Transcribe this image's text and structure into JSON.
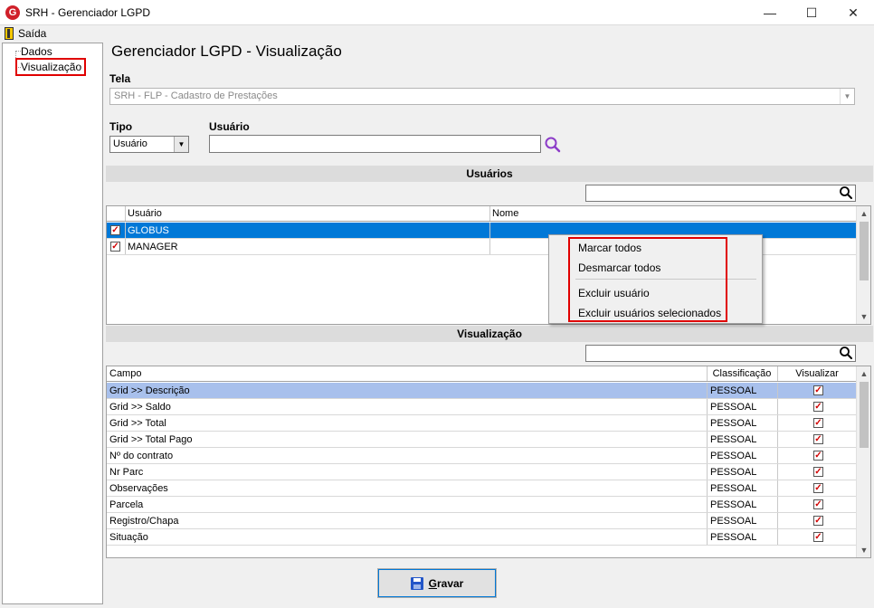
{
  "window": {
    "title": "SRH - Gerenciador LGPD",
    "minimize_glyph": "—",
    "maximize_glyph": "☐",
    "close_glyph": "✕"
  },
  "menu": {
    "exit_label": "Saída",
    "exit_icon": "exit-door-icon"
  },
  "nav": {
    "items": [
      {
        "label": "Dados",
        "selected": false
      },
      {
        "label": "Visualização",
        "selected": true
      }
    ]
  },
  "page": {
    "title": "Gerenciador LGPD - Visualização"
  },
  "form": {
    "tela_label": "Tela",
    "tela_value": "SRH - FLP - Cadastro de Prestações",
    "tipo_label": "Tipo",
    "tipo_value": "Usuário",
    "usuario_label": "Usuário",
    "usuario_value": ""
  },
  "users_section": {
    "header": "Usuários",
    "search_value": "",
    "columns": [
      "Usuário",
      "Nome"
    ],
    "rows": [
      {
        "checked": true,
        "usuario": "GLOBUS",
        "nome": "",
        "selected": true
      },
      {
        "checked": true,
        "usuario": "MANAGER",
        "nome": "",
        "selected": false
      }
    ]
  },
  "context_menu": {
    "items": [
      "Marcar todos",
      "Desmarcar todos",
      "Excluir usuário",
      "Excluir usuários selecionados"
    ]
  },
  "view_section": {
    "header": "Visualização",
    "search_value": "",
    "columns": [
      "Campo",
      "Classificação",
      "Visualizar"
    ],
    "rows": [
      {
        "campo": "Grid >> Descrição",
        "classificacao": "PESSOAL",
        "visualizar": true,
        "selected": true
      },
      {
        "campo": "Grid >> Saldo",
        "classificacao": "PESSOAL",
        "visualizar": true,
        "selected": false
      },
      {
        "campo": "Grid >> Total",
        "classificacao": "PESSOAL",
        "visualizar": true,
        "selected": false
      },
      {
        "campo": "Grid >> Total Pago",
        "classificacao": "PESSOAL",
        "visualizar": true,
        "selected": false
      },
      {
        "campo": "Nº do contrato",
        "classificacao": "PESSOAL",
        "visualizar": true,
        "selected": false
      },
      {
        "campo": "Nr Parc",
        "classificacao": "PESSOAL",
        "visualizar": true,
        "selected": false
      },
      {
        "campo": "Observações",
        "classificacao": "PESSOAL",
        "visualizar": true,
        "selected": false
      },
      {
        "campo": "Parcela",
        "classificacao": "PESSOAL",
        "visualizar": true,
        "selected": false
      },
      {
        "campo": "Registro/Chapa",
        "classificacao": "PESSOAL",
        "visualizar": true,
        "selected": false
      },
      {
        "campo": "Situação",
        "classificacao": "PESSOAL",
        "visualizar": true,
        "selected": false
      }
    ]
  },
  "actions": {
    "save_label": "Gravar"
  },
  "colors": {
    "selection_blue": "#0078d7",
    "selection_light": "#a8c0ec",
    "check_red": "#d00000",
    "highlight_red": "#e00000",
    "search_purple": "#8c3cc8"
  }
}
